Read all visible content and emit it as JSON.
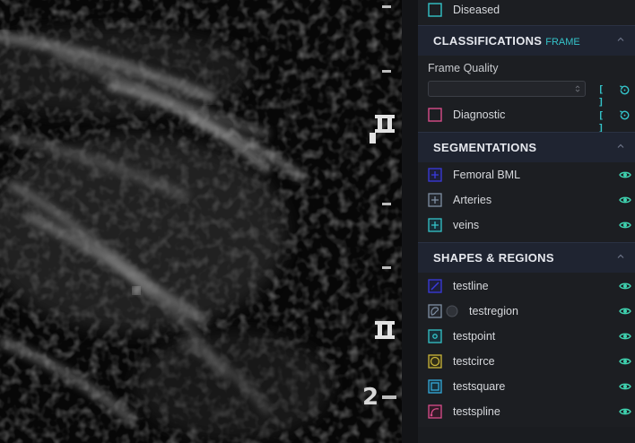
{
  "viewport": {
    "depth_label": "2",
    "ruler_glyph": "II"
  },
  "labels": {
    "diseased": {
      "label": "Diseased",
      "color": "#34c3c9",
      "icon": "checkbox-icon"
    }
  },
  "classifications": {
    "title": "CLASSIFICATIONS",
    "subtitle": "FRAME",
    "frame_quality_label": "Frame Quality",
    "frame_quality_value": "",
    "diagnostic": {
      "label": "Diagnostic",
      "color": "#d94c8a",
      "icon": "checkbox-icon"
    },
    "bracket_text": "[ ]"
  },
  "segmentations": {
    "title": "SEGMENTATIONS",
    "items": [
      {
        "label": "Femoral BML",
        "color": "#3a3adf",
        "icon": "crosshair-square-icon"
      },
      {
        "label": "Arteries",
        "color": "#7f8fa3",
        "icon": "crosshair-square-icon"
      },
      {
        "label": "veins",
        "color": "#34c3c9",
        "icon": "crosshair-square-icon"
      }
    ]
  },
  "shapes_regions": {
    "title": "SHAPES & REGIONS",
    "items": [
      {
        "label": "testline",
        "color": "#3a3adf",
        "icon": "line-tool-icon"
      },
      {
        "label": "testregion",
        "color": "#7f8fa3",
        "icon": "freehand-region-icon"
      },
      {
        "label": "testpoint",
        "color": "#34c3c9",
        "icon": "point-tool-icon"
      },
      {
        "label": "testcirce",
        "color": "#c9b43a",
        "icon": "circle-tool-icon"
      },
      {
        "label": "testsquare",
        "color": "#34a8d9",
        "icon": "square-tool-icon"
      },
      {
        "label": "testspline",
        "color": "#d94c8a",
        "icon": "spline-tool-icon"
      }
    ]
  },
  "colors": {
    "accent": "#34c3c9",
    "eye": "#3fd3b0"
  }
}
